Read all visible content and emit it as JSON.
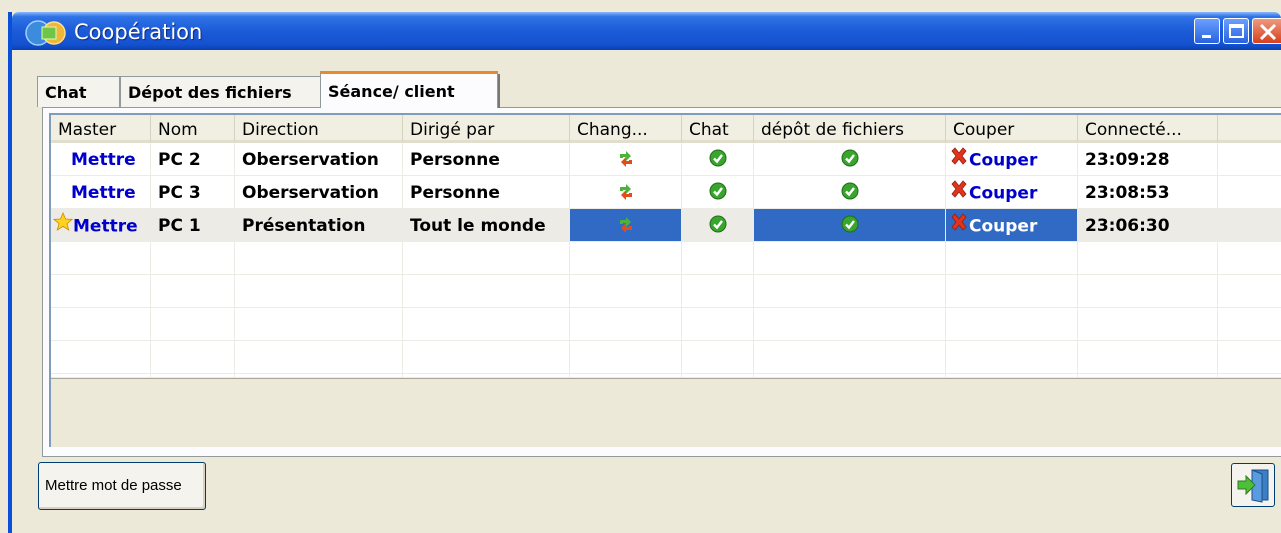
{
  "window": {
    "title": "Coopération"
  },
  "tabs": [
    {
      "label": "Chat"
    },
    {
      "label": "Dépot des fichiers"
    },
    {
      "label": "Séance/ client"
    }
  ],
  "table": {
    "columns": [
      "Master",
      "Nom",
      "Direction",
      "Dirigé par",
      "Chang...",
      "Chat",
      "dépôt de fichiers",
      "Couper",
      "Connecté..."
    ],
    "rows": [
      {
        "master": "Mettre",
        "master_star": false,
        "nom": "PC 2",
        "direction": "Oberservation",
        "dirige": "Personne",
        "change_icon": "swap-arrows-icon",
        "chat_icon": "green-check-icon",
        "depot_icon": "green-check-icon",
        "couper": "Couper",
        "connecte": "23:09:28",
        "selected": false
      },
      {
        "master": "Mettre",
        "master_star": false,
        "nom": "PC 3",
        "direction": "Oberservation",
        "dirige": "Personne",
        "change_icon": "swap-arrows-icon",
        "chat_icon": "green-check-icon",
        "depot_icon": "green-check-icon",
        "couper": "Couper",
        "connecte": "23:08:53",
        "selected": false
      },
      {
        "master": "Mettre",
        "master_star": true,
        "nom": "PC 1",
        "direction": "Présentation",
        "dirige": "Tout le monde",
        "change_icon": "swap-arrows-icon",
        "chat_icon": "green-check-icon",
        "depot_icon": "green-check-icon",
        "couper": "Couper",
        "connecte": "23:06:30",
        "selected": true
      }
    ]
  },
  "footer": {
    "password_button": "Mettre mot de passe",
    "exit_icon": "exit-door-icon"
  },
  "colors": {
    "titlebar": "#1c5bd8",
    "selection": "#316ac5",
    "link": "#0000cc",
    "check": "#3aa52e",
    "cross": "#e0341c"
  }
}
